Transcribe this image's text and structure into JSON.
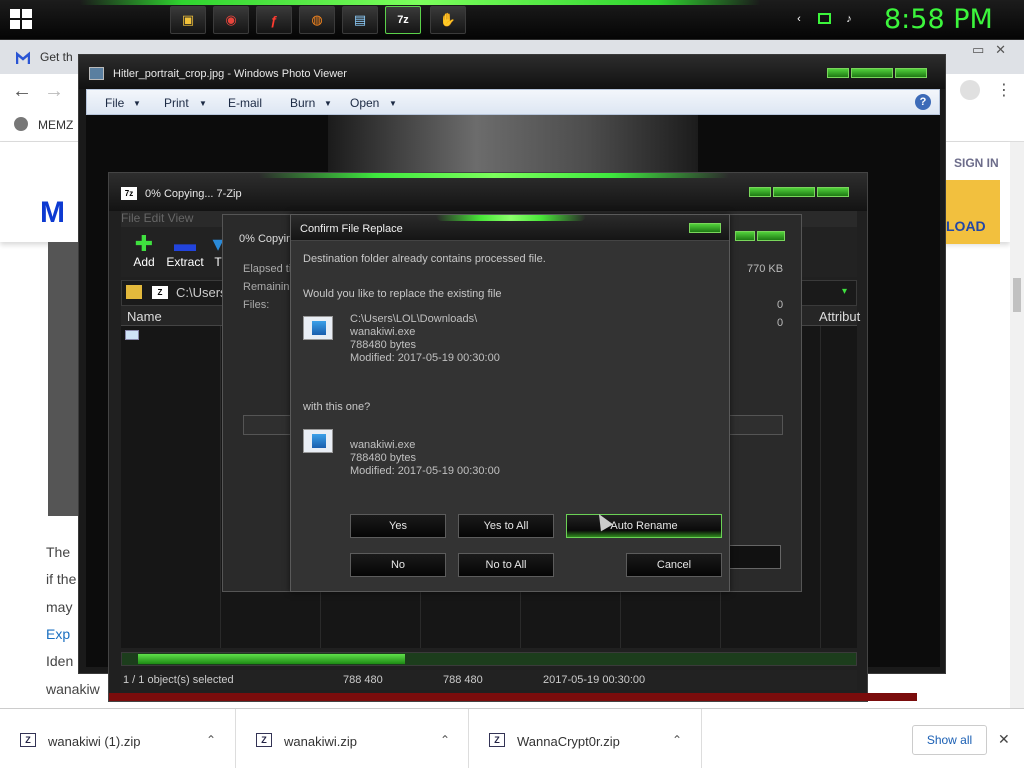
{
  "taskbar": {
    "clock": "8:58 PM",
    "pinned": [
      {
        "id": "explorer",
        "glyph": "▣",
        "color": "#f2c23a"
      },
      {
        "id": "chrome",
        "glyph": "◉",
        "color": "#e8453c"
      },
      {
        "id": "flash",
        "glyph": "ƒ",
        "color": "#ff3b30"
      },
      {
        "id": "firefox",
        "glyph": "◍",
        "color": "#ff8a1e"
      },
      {
        "id": "photo-viewer",
        "glyph": "▤",
        "color": "#8fd0ff"
      },
      {
        "id": "7zip",
        "glyph": "7z",
        "color": "#ffffff"
      },
      {
        "id": "handshake",
        "glyph": "✋",
        "color": "#f0b060"
      }
    ]
  },
  "browser": {
    "tab_title": "Get th",
    "bookmark_label": "MEMZ",
    "sign_in": "SIGN IN",
    "download_button": "LOAD",
    "page_lines": [
      "The",
      "if the",
      "may",
      "Exp",
      "Iden",
      "wanakiw"
    ]
  },
  "downloads": {
    "items": [
      {
        "name": "wanakiwi (1).zip"
      },
      {
        "name": "wanakiwi.zip"
      },
      {
        "name": "WannaCrypt0r.zip"
      }
    ],
    "show_all": "Show all"
  },
  "photo_viewer": {
    "title": "Hitler_portrait_crop.jpg - Windows Photo Viewer",
    "menu": [
      "File",
      "Print",
      "E-mail",
      "Burn",
      "Open"
    ],
    "help": "?"
  },
  "zip_main": {
    "title": "0% Copying... 7-Zip",
    "menu": "File   Edit   View",
    "tools": {
      "add": "Add",
      "extract": "Extract",
      "test": "T"
    },
    "path": "C:\\Users",
    "col_name": "Name",
    "col_attrib": "Attribut",
    "status": {
      "selected": "1 / 1 object(s) selected",
      "size": "788 480",
      "packed": "788 480",
      "modified": "2017-05-19 00:30:00"
    },
    "progress_fraction": 0.38
  },
  "copy_dialog": {
    "title": "0% Copyin",
    "elapsed": "Elapsed ti",
    "remaining": "Remaining",
    "files": "Files:",
    "size_val": "770 KB",
    "files_val": "0",
    "errors_val": "0"
  },
  "replace_dialog": {
    "title": "Confirm File Replace",
    "message": "Destination folder already contains processed file.",
    "question": "Would you like to replace the existing file",
    "existing": {
      "path": "C:\\Users\\LOL\\Downloads\\",
      "name": "wanakiwi.exe",
      "size": "788480 bytes",
      "modified": "Modified: 2017-05-19 00:30:00"
    },
    "with_label": "with this one?",
    "incoming": {
      "name": "wanakiwi.exe",
      "size": "788480 bytes",
      "modified": "Modified: 2017-05-19 00:30:00"
    },
    "buttons": {
      "yes": "Yes",
      "yes_to_all": "Yes to All",
      "auto_rename": "Auto Rename",
      "no": "No",
      "no_to_all": "No to All",
      "cancel": "Cancel"
    }
  }
}
